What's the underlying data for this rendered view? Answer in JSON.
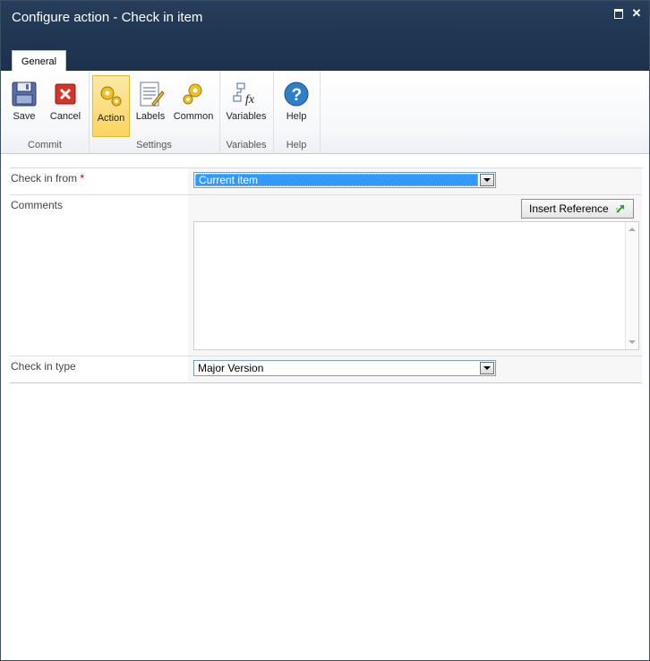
{
  "window": {
    "title": "Configure action - Check in item"
  },
  "tabs": [
    {
      "label": "General"
    }
  ],
  "ribbon": {
    "groups": [
      {
        "label": "Commit",
        "buttons": [
          {
            "label": "Save",
            "icon": "save-icon"
          },
          {
            "label": "Cancel",
            "icon": "cancel-icon"
          }
        ]
      },
      {
        "label": "Settings",
        "buttons": [
          {
            "label": "Action",
            "icon": "gears-icon",
            "active": true
          },
          {
            "label": "Labels",
            "icon": "labels-icon"
          },
          {
            "label": "Common",
            "icon": "gears-icon"
          }
        ]
      },
      {
        "label": "Variables",
        "buttons": [
          {
            "label": "Variables",
            "icon": "variables-fx-icon"
          }
        ]
      },
      {
        "label": "Help",
        "buttons": [
          {
            "label": "Help",
            "icon": "help-icon"
          }
        ]
      }
    ]
  },
  "form": {
    "check_in_from": {
      "label": "Check in from",
      "required_mark": "*",
      "value": "Current item"
    },
    "comments": {
      "label": "Comments",
      "insert_reference_label": "Insert Reference",
      "value": ""
    },
    "check_in_type": {
      "label": "Check in type",
      "value": "Major Version"
    }
  },
  "colors": {
    "title_bar": "#1f3551",
    "active_button": "#fbd460",
    "selection": "#3399ff",
    "required": "#cc0000"
  }
}
